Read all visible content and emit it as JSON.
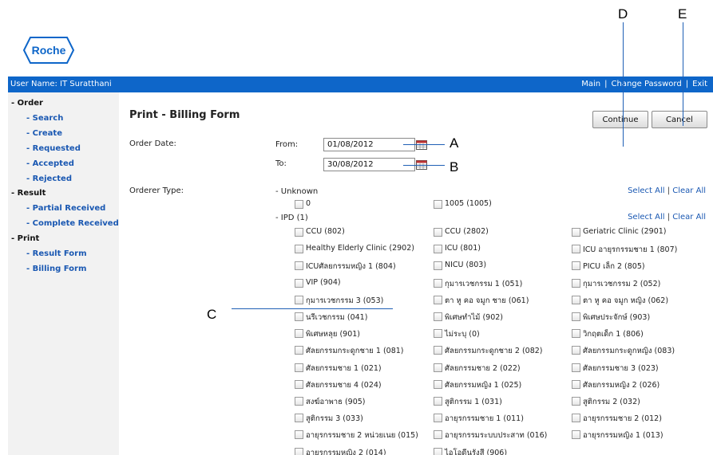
{
  "brand": {
    "logo_text": "Roche",
    "logo_color": "#0e66c9"
  },
  "topbar": {
    "user_label": "User Name: IT Suratthani",
    "links": [
      "Main",
      "Change Password",
      "Exit"
    ],
    "separator": "|",
    "color": "#0e66c9"
  },
  "sidebar": {
    "order": "- Order",
    "search": "- Search",
    "create": "- Create",
    "requested": "- Requested",
    "accepted": "- Accepted",
    "rejected": "- Rejected",
    "result": "- Result",
    "partial": "- Partial Received",
    "complete": "- Complete Received",
    "print": "- Print",
    "result_form": "- Result Form",
    "billing_form": "- Billing Form"
  },
  "main": {
    "title": "Print - Billing Form",
    "continue_label": "Continue",
    "cancel_label": "Cancel",
    "order_date_label": "Order Date:",
    "from_label": "From:",
    "from_value": "01/08/2012",
    "to_label": "To:",
    "to_value": "30/08/2012",
    "orderer_type_label": "Orderer Type:",
    "select_all": "Select All",
    "clear_all": "Clear All",
    "link_sep": "|"
  },
  "groups": {
    "unknown": {
      "label": "- Unknown",
      "items": [
        "0",
        "1005 (1005)"
      ]
    },
    "ipd": {
      "label": "- IPD (1)",
      "items": [
        "CCU (802)",
        "CCU (2802)",
        "Geriatric Clinic (2901)",
        "Healthy Elderly Clinic (2902)",
        "ICU (801)",
        "ICU อายุรกรรมชาย 1 (807)",
        "ICUศัลยกรรมหญิง 1 (804)",
        "NICU (803)",
        "PICU เล็ก 2 (805)",
        "VIP (904)",
        "กุมารเวชกรรม 1 (051)",
        "กุมารเวชกรรม 2 (052)",
        "กุมารเวชกรรม 3 (053)",
        "ตา หู คอ จมูก ชาย (061)",
        "ตา หู คอ จมูก หญิง (062)",
        "นรีเวชกรรม (041)",
        "พิเศษทำไม้ (902)",
        "พิเศษประจักษ์ (903)",
        "พิเศษหลุย (901)",
        "ไม่ระบุ (0)",
        "วิกฤตเด็ก 1 (806)",
        "ศัลยกรรมกระดูกชาย 1 (081)",
        "ศัลยกรรมกระดูกชาย 2 (082)",
        "ศัลยกรรมกระดูกหญิง (083)",
        "ศัลยกรรมชาย 1 (021)",
        "ศัลยกรรมชาย 2 (022)",
        "ศัลยกรรมชาย 3 (023)",
        "ศัลยกรรมชาย 4 (024)",
        "ศัลยกรรมหญิง 1 (025)",
        "ศัลยกรรมหญิง 2 (026)",
        "สงฆ์อาพาธ (905)",
        "สูติกรรม 1 (031)",
        "สูติกรรม 2 (032)",
        "สูติกรรม 3 (033)",
        "อายุรกรรมชาย 1 (011)",
        "อายุรกรรมชาย 2 (012)",
        "อายุรกรรมชาย 2 หน่วยเนย (015)",
        "อายุรกรรมระบบประสาท (016)",
        "อายุรกรรมหญิง 1 (013)",
        "อายุรกรรมหญิง 2 (014)",
        "ไอโอดีนรังสี (906)"
      ]
    }
  },
  "annotations": {
    "A": "A",
    "B": "B",
    "C": "C",
    "D": "D",
    "E": "E"
  },
  "icons": {
    "calendar": "calendar-icon",
    "logo": "roche-logo"
  }
}
